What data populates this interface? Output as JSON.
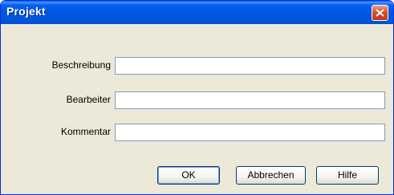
{
  "window": {
    "title": "Projekt"
  },
  "form": {
    "fields": [
      {
        "label": "Beschreibung",
        "value": ""
      },
      {
        "label": "Bearbeiter",
        "value": ""
      },
      {
        "label": "Kommentar",
        "value": ""
      }
    ]
  },
  "buttons": {
    "ok": "OK",
    "cancel": "Abbrechen",
    "help": "Hilfe"
  },
  "colors": {
    "title_bar": "#0054e3",
    "close_button": "#c0381b",
    "dialog_background": "#ece9d8"
  },
  "icons": {
    "close": "close-icon"
  }
}
